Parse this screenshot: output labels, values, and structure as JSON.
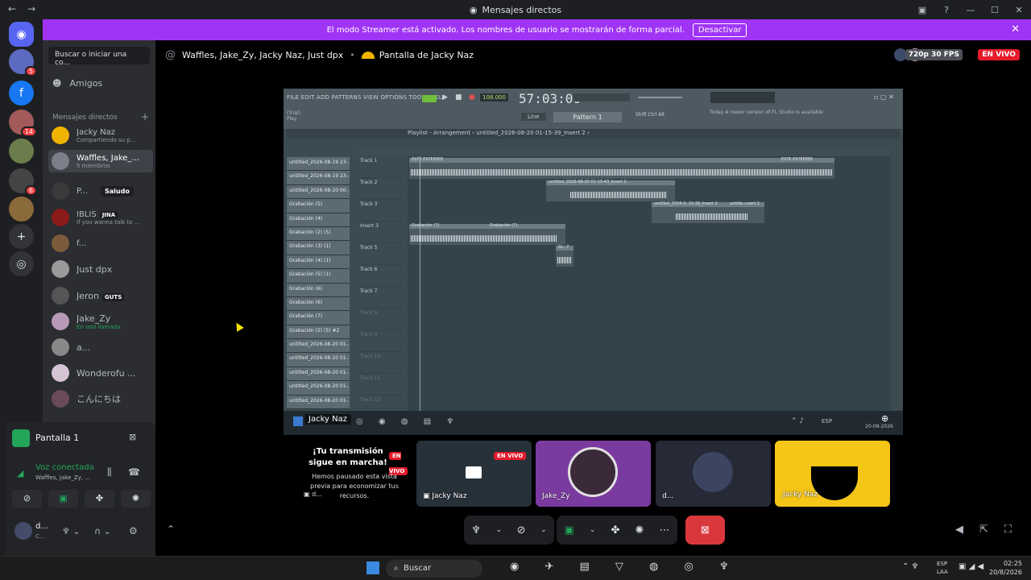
{
  "window": {
    "title": "Mensajes directos"
  },
  "banner": {
    "text": "El modo Streamer está activado. Los nombres de usuario se mostrarán de forma parcial.",
    "button": "Desactivar"
  },
  "rail": {
    "badges": [
      "5",
      "14",
      "6"
    ]
  },
  "sidebar": {
    "search_placeholder": "Buscar o iniciar una co...",
    "friends": "Amigos",
    "dm_header": "Mensajes directos",
    "items": [
      {
        "name": "Jacky Naz",
        "sub": "Compartiendo su p..."
      },
      {
        "name": "Waffles, Jake_...",
        "sub": "5 miembros"
      },
      {
        "name": "P...",
        "tag": "Saludo"
      },
      {
        "name": "IBLIS",
        "tag": "JINA",
        "sub": "If you wanna talk to ..."
      },
      {
        "name": "f...",
        "sub": ""
      },
      {
        "name": "Just dpx",
        "sub": ""
      },
      {
        "name": "Jeron",
        "tag": "GUTS"
      },
      {
        "name": "Jake_Zy",
        "sub": "En una llamada"
      },
      {
        "name": "a...",
        "sub": ""
      },
      {
        "name": "Wonderofu ...",
        "sub": ""
      },
      {
        "name": "こんにちは",
        "sub": ""
      }
    ]
  },
  "voice_panel": {
    "stream_title": "Pantalla 1",
    "connected": "Voz conectada",
    "channel": "Waffles, Jake_Zy, ...",
    "user": "d...",
    "user_status": "C..."
  },
  "header": {
    "conversation": "Waffles, Jake_Zy, Jacky Naz, Just dpx",
    "stream": "Pantalla de Jacky Naz",
    "quality": "720p 30 FPS",
    "live": "EN VIVO"
  },
  "fl": {
    "menu": "FILE  EDIT  ADD  PATTERNS  VIEW  OPTIONS  TOOLS  HELP",
    "tempo": "108.000",
    "time": "57:03:00",
    "pattern": "Pattern 1",
    "note": "Today  A newer version of FL Studio is available",
    "playlist": "Playlist - Arrangement  ›  untitled_2026-08-20 01-15-39_Insert 2  ›",
    "mode": "Line",
    "channels": [
      "untitled_2026-08-19 23-...",
      "untitled_2026-08-19 23-...",
      "untitled_2026-08-20 00-...",
      "Grabación (5)",
      "Grabación (4)",
      "Grabación (2) (5)",
      "Grabación (3) (1)",
      "Grabación (4) (1)",
      "Grabación (5) (1)",
      "Grabación (6)",
      "Grabación (6)",
      "Grabación (7)",
      "Grabación (2) (5) #2",
      "untitled_2026-08-20 01-...",
      "untitled_2026-08-20 01-...",
      "untitled_2026-08-20 01-...",
      "untitled_2026-08-20 01-...",
      "untitled_2026-08-20 01-..."
    ],
    "tracks": [
      "Track 1",
      "Track 2",
      "Track 3",
      "Insert 3",
      "Track 5",
      "Track 6",
      "Track 7",
      "Track 8",
      "Track 9",
      "Track 10",
      "Track 11",
      "Track 12"
    ],
    "clips": [
      "ESTE ESTEEEEE",
      "ESTE ESTEEEEE",
      "untitled_2026-08-20 01-13-43_Insert 2",
      "untitled_2026-0..15-39_Insert 2",
      "untitle..nsert 2",
      "Grabación (7)",
      "Grabación (7)",
      "Gr...7"
    ],
    "overlay_name": "Jacky Naz",
    "tb_lang": "ESP",
    "tb_date": "20-08-2026"
  },
  "tiles": {
    "paused_title": "¡Tu transmisión sigue en marcha!",
    "paused_sub": "Hemos pausado esta vista previa para economizar tus recursos.",
    "paused_user": "d...",
    "live": "EN VIVO",
    "names": [
      "Jacky Naz",
      "Jake_Zy",
      "d...",
      "Jacky Naz"
    ]
  },
  "ostaskbar": {
    "search": "Buscar",
    "lang1": "ESP",
    "lang2": "LAA",
    "time": "02:25",
    "date": "20/8/2026"
  }
}
